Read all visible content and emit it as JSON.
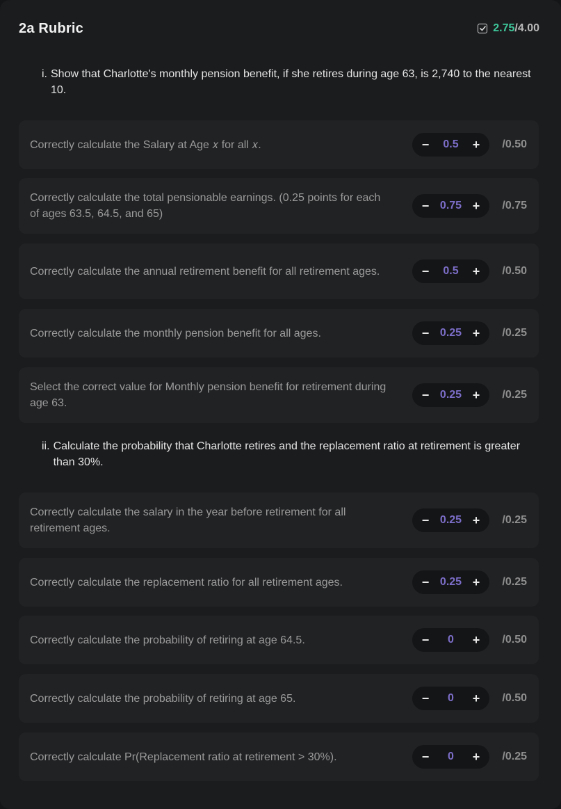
{
  "header": {
    "title": "2a Rubric",
    "score_earned": "2.75",
    "score_sep": "/",
    "score_total": "4.00",
    "icon": "checkbox-checked-icon"
  },
  "sections": [
    {
      "number": "i.",
      "text": "Show that Charlotte's monthly pension benefit, if she retires during age 63, is 2,740 to the nearest 10."
    },
    {
      "number": "ii.",
      "text": "Calculate the probability that Charlotte retires and the replacement ratio at retirement is greater than 30%."
    }
  ],
  "items": [
    {
      "text": "Correctly calculate the Salary at Age 𝑥 for all 𝑥.",
      "minus": "−",
      "value": "0.5",
      "plus": "+",
      "max": "/0.50"
    },
    {
      "text": "Correctly calculate the total pensionable earnings. (0.25 points for each of ages 63.5, 64.5, and 65)",
      "minus": "−",
      "value": "0.75",
      "plus": "+",
      "max": "/0.75"
    },
    {
      "text": "Correctly calculate the annual retirement benefit for all retirement ages.",
      "minus": "−",
      "value": "0.5",
      "plus": "+",
      "max": "/0.50"
    },
    {
      "text": "Correctly calculate the monthly pension benefit for all ages.",
      "minus": "−",
      "value": "0.25",
      "plus": "+",
      "max": "/0.25"
    },
    {
      "text": "Select the correct value for Monthly pension benefit for retirement during age 63.",
      "minus": "−",
      "value": "0.25",
      "plus": "+",
      "max": "/0.25"
    },
    {
      "text": "Correctly calculate the salary in the year before retirement for all retirement ages.",
      "minus": "−",
      "value": "0.25",
      "plus": "+",
      "max": "/0.25"
    },
    {
      "text": "Correctly calculate the replacement ratio for all retirement ages.",
      "minus": "−",
      "value": "0.25",
      "plus": "+",
      "max": "/0.25"
    },
    {
      "text": "Correctly calculate the probability of retiring at age 64.5.",
      "minus": "−",
      "value": "0",
      "plus": "+",
      "max": "/0.50"
    },
    {
      "text": "Correctly calculate the probability of retiring at age 65.",
      "minus": "−",
      "value": "0",
      "plus": "+",
      "max": "/0.50"
    },
    {
      "text": "Correctly calculate Pr(Replacement ratio at retirement > 30%).",
      "minus": "−",
      "value": "0",
      "plus": "+",
      "max": "/0.25"
    }
  ],
  "colors": {
    "accent_green": "#3ec79a",
    "value_purple": "#7c6ec9",
    "background": "#1b1c1e",
    "card": "#212224"
  }
}
